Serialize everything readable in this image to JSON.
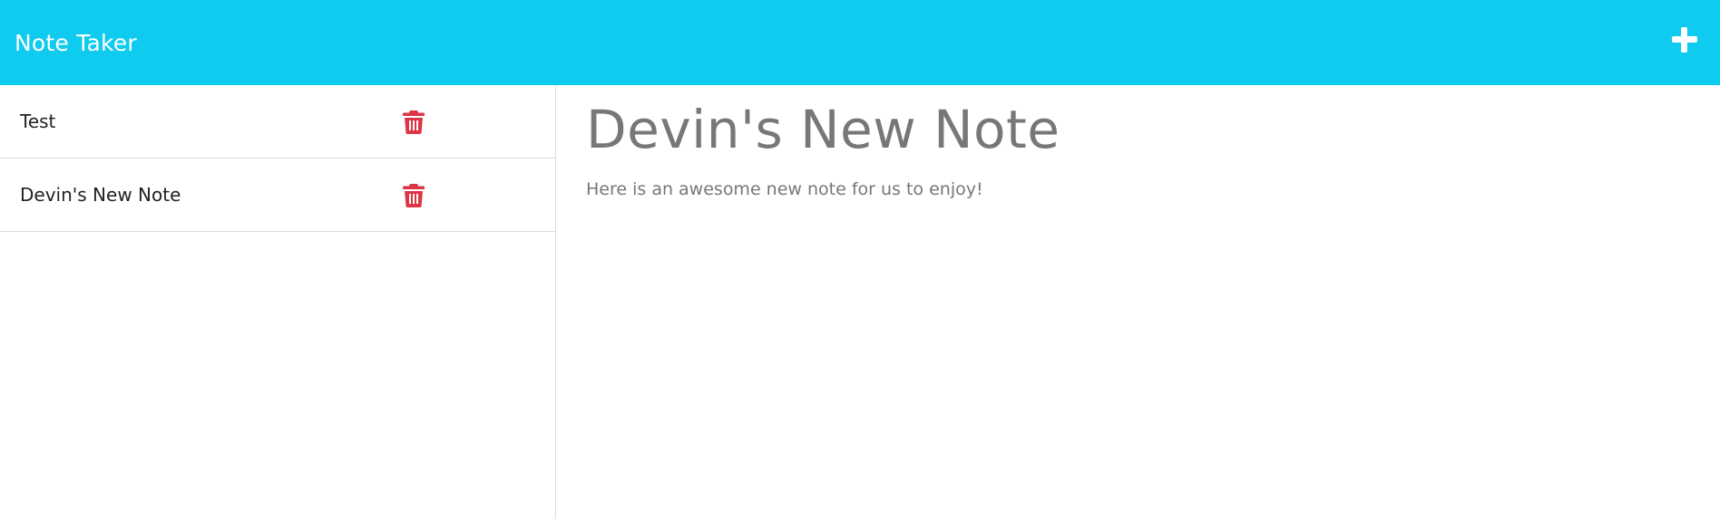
{
  "app": {
    "title": "Note Taker"
  },
  "navbar": {
    "new_note_icon": "plus-icon"
  },
  "notes": [
    {
      "title": "Test",
      "delete_icon": "trash-icon"
    },
    {
      "title": "Devin's New Note",
      "delete_icon": "trash-icon"
    }
  ],
  "active_note": {
    "title": "Devin's New Note",
    "text": "Here is an awesome new note for us to enjoy!"
  },
  "colors": {
    "navbar": "#0ecbef",
    "delete": "#dc3545",
    "note_text": "#777777"
  }
}
